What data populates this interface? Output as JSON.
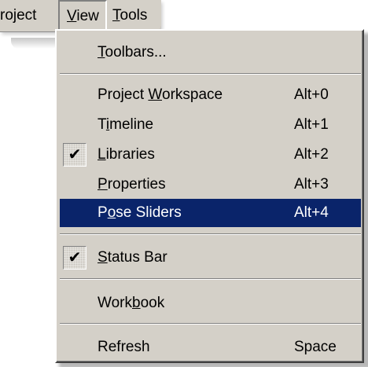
{
  "menubar": {
    "items": [
      {
        "text": "roject",
        "accel": ""
      },
      {
        "text": "View",
        "accel": "V"
      },
      {
        "text": "Tools",
        "accel": "T"
      }
    ]
  },
  "view_menu": {
    "items": [
      {
        "pre": "",
        "accel": "T",
        "post": "oolbars...",
        "shortcut": "",
        "checked": false
      },
      {
        "pre": "Project ",
        "accel": "W",
        "post": "orkspace",
        "shortcut": "Alt+0",
        "checked": false
      },
      {
        "pre": "T",
        "accel": "i",
        "post": "meline",
        "shortcut": "Alt+1",
        "checked": false
      },
      {
        "pre": "",
        "accel": "L",
        "post": "ibraries",
        "shortcut": "Alt+2",
        "checked": true
      },
      {
        "pre": "",
        "accel": "P",
        "post": "roperties",
        "shortcut": "Alt+3",
        "checked": false
      },
      {
        "pre": "P",
        "accel": "o",
        "post": "se Sliders",
        "shortcut": "Alt+4",
        "checked": false,
        "highlighted": true
      },
      {
        "pre": "",
        "accel": "S",
        "post": "tatus Bar",
        "shortcut": "",
        "checked": true
      },
      {
        "pre": "Work",
        "accel": "b",
        "post": "ook",
        "shortcut": "",
        "checked": false
      },
      {
        "pre": "Refresh",
        "accel": "",
        "post": "",
        "shortcut": "Space",
        "checked": false
      }
    ],
    "check_glyph": "✔"
  },
  "colors": {
    "menu_bg": "#d4d0c8",
    "highlight_bg": "#0a246a",
    "highlight_text": "#ffffff"
  }
}
